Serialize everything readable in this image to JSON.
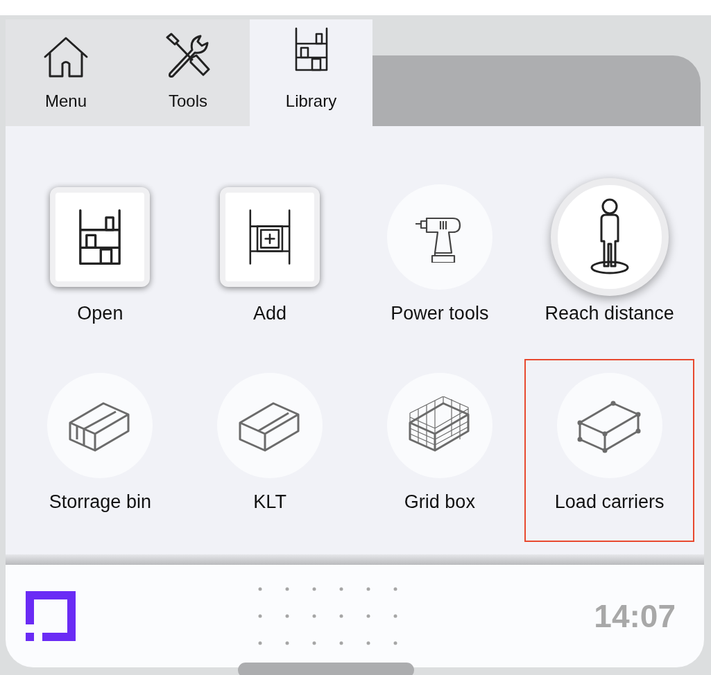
{
  "tabs": [
    {
      "label": "Menu",
      "selected": false
    },
    {
      "label": "Tools",
      "selected": false
    },
    {
      "label": "Library",
      "selected": true
    }
  ],
  "items": [
    {
      "label": "Open",
      "kind": "square",
      "highlighted": false
    },
    {
      "label": "Add",
      "kind": "square",
      "highlighted": false
    },
    {
      "label": "Power tools",
      "kind": "circle",
      "highlighted": false
    },
    {
      "label": "Reach distance",
      "kind": "raised",
      "highlighted": false
    },
    {
      "label": "Storrage bin",
      "kind": "circle",
      "highlighted": false
    },
    {
      "label": "KLT",
      "kind": "circle",
      "highlighted": false
    },
    {
      "label": "Grid box",
      "kind": "circle",
      "highlighted": false
    },
    {
      "label": "Load carriers",
      "kind": "circle",
      "highlighted": true
    }
  ],
  "footer": {
    "time": "14:07"
  }
}
